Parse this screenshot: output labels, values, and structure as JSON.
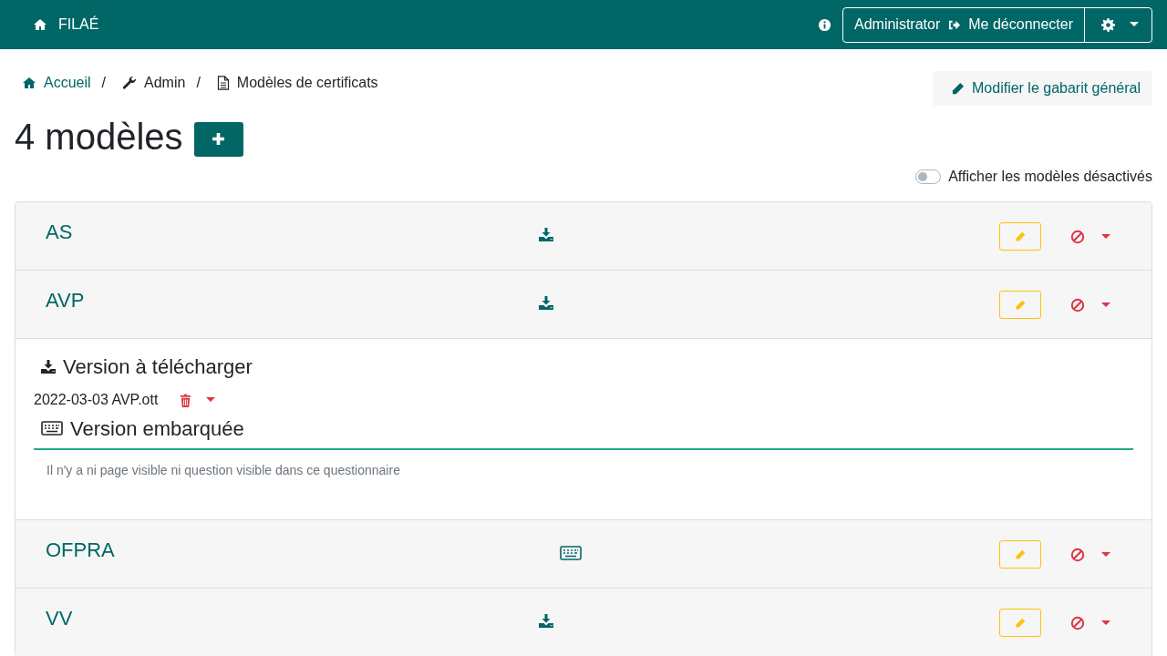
{
  "navbar": {
    "brand": "FILAÉ",
    "user": "Administrator",
    "logout": "Me déconnecter"
  },
  "breadcrumb": [
    {
      "label": "Accueil",
      "kind": "link"
    },
    {
      "label": "Admin",
      "kind": "text"
    },
    {
      "label": "Modèles de certificats",
      "kind": "current"
    }
  ],
  "separators": [
    "/",
    "/"
  ],
  "edit_template_button": "Modifier le gabarit général",
  "heading": "4 modèles",
  "toggle": {
    "label": "Afficher les modèles désactivés",
    "on": false
  },
  "models": [
    {
      "name": "AS",
      "kind": "download"
    },
    {
      "name": "AVP",
      "kind": "download",
      "details": {
        "download_heading": "Version à télécharger",
        "files": [
          "2022-03-03 AVP.ott"
        ],
        "embedded_heading": "Version embarquée",
        "message": "Il n'y a ni page visible ni question visible dans ce questionnaire"
      }
    },
    {
      "name": "OFPRA",
      "kind": "embedded"
    },
    {
      "name": "VV",
      "kind": "download"
    }
  ]
}
